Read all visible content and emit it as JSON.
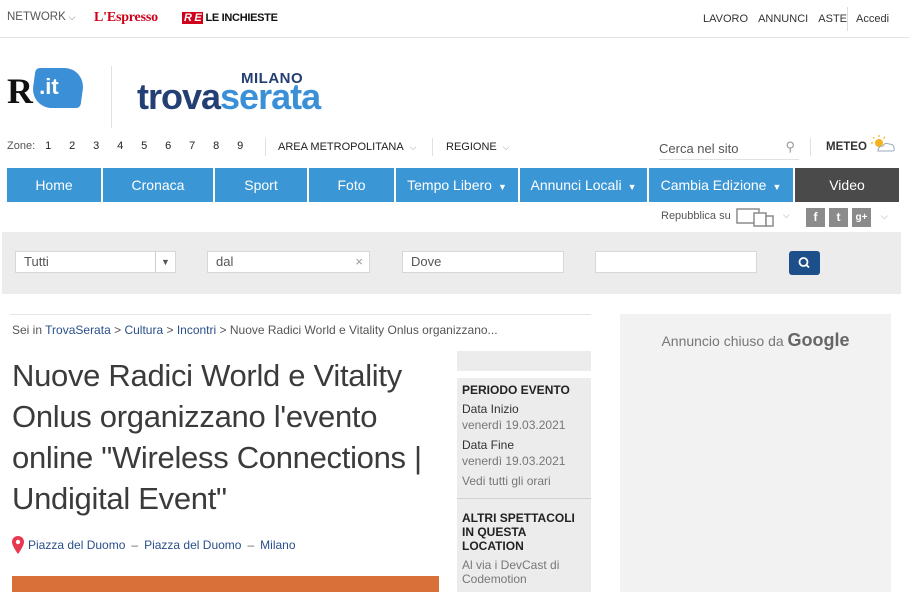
{
  "topbar": {
    "network": "NETWORK",
    "espresso": "L'Espresso",
    "inchieste_prefix": "R E",
    "inchieste": "LE INCHIESTE",
    "links": [
      "LAVORO",
      "ANNUNCI",
      "ASTE"
    ],
    "login": "Accedi"
  },
  "logos": {
    "repubblica_r": "R",
    "repubblica_it": ".it",
    "trova_milano": "MILANO",
    "trova_a": "trova",
    "trova_b": "serata"
  },
  "zones": {
    "label": "Zone:",
    "numbers": [
      "1",
      "2",
      "3",
      "4",
      "5",
      "6",
      "7",
      "8",
      "9"
    ],
    "area": "AREA METROPOLITANA",
    "region": "REGIONE"
  },
  "search": {
    "placeholder": "Cerca nel sito"
  },
  "meteo": "METEO",
  "nav": [
    {
      "label": "Home",
      "dropdown": false
    },
    {
      "label": "Cronaca",
      "dropdown": false
    },
    {
      "label": "Sport",
      "dropdown": false
    },
    {
      "label": "Foto",
      "dropdown": false
    },
    {
      "label": "Tempo Libero",
      "dropdown": true
    },
    {
      "label": "Annunci Locali",
      "dropdown": true
    },
    {
      "label": "Cambia Edizione",
      "dropdown": true
    },
    {
      "label": "Video",
      "dropdown": false
    }
  ],
  "share": {
    "label": "Repubblica su",
    "social": [
      "f",
      "t",
      "g+"
    ]
  },
  "filters": {
    "category": "Tutti",
    "from": "dal",
    "where": "Dove",
    "extra": ""
  },
  "breadcrumb": {
    "prefix": "Sei in",
    "items": [
      "TrovaSerata",
      "Cultura",
      "Incontri"
    ],
    "current": "Nuove Radici World e Vitality Onlus organizzano..."
  },
  "event": {
    "title": "Nuove Radici World e Vitality Onlus organizzano l'evento online \"Wireless Connections | Undigital Event\"",
    "location_a": "Piazza del Duomo",
    "location_b": "Piazza del Duomo",
    "city": "Milano"
  },
  "side": {
    "period_heading": "PERIODO EVENTO",
    "start_label": "Data Inizio",
    "start_value": "venerdì 19.03.2021",
    "end_label": "Data Fine",
    "end_value": "venerdì 19.03.2021",
    "all_times": "Vedi tutti gli orari",
    "other_heading": "ALTRI SPETTACOLI IN QUESTA LOCATION",
    "other_item": "Al via i DevCast di Codemotion"
  },
  "ad": {
    "text": "Annuncio chiuso da",
    "brand": "Google"
  },
  "colors": {
    "nav_blue": "#3b96d6",
    "nav_dark": "#4a4a4a",
    "brand_navy": "#243f73",
    "espresso_red": "#d0021b",
    "search_button": "#1d4f8a",
    "pin": "#e8384f"
  }
}
